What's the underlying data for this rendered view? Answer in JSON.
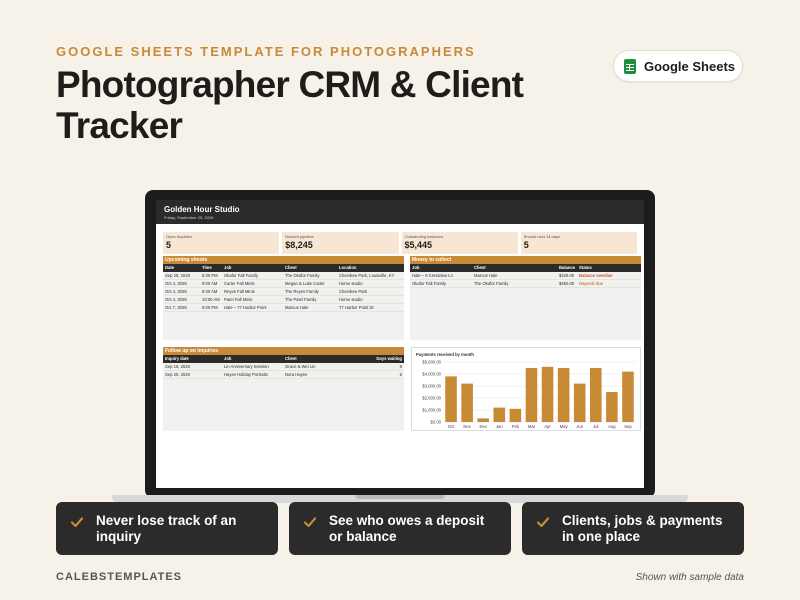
{
  "eyebrow": "GOOGLE SHEETS TEMPLATE FOR PHOTOGRAPHERS",
  "title": "Photographer CRM & Client Tracker",
  "badge": {
    "label": "Google Sheets",
    "icon": "google-sheets-icon",
    "icon_color": "#1e8e3e"
  },
  "sheet": {
    "studio": "Golden Hour Studio",
    "date": "Friday, September 25, 2026",
    "kpis": [
      {
        "label": "Open Inquiries",
        "value": "5"
      },
      {
        "label": "Booked pipeline",
        "value": "$8,245"
      },
      {
        "label": "Outstanding balances",
        "value": "$5,445"
      },
      {
        "label": "Shoots next 14 days",
        "value": "5"
      }
    ],
    "upcoming": {
      "title": "Upcoming shoots",
      "headers": [
        "Date",
        "Time",
        "Job",
        "Client",
        "Location"
      ],
      "rows": [
        [
          "Sep 29, 2026",
          "5:30 PM",
          "Okafor Fall Family",
          "The Okafor Family",
          "Cherokee Park, Louisville, KY"
        ],
        [
          "Oct 4, 2026",
          "9:00 AM",
          "Carter Fall Minis",
          "Megan & Luke Carter",
          "Home studio"
        ],
        [
          "Oct 4, 2026",
          "9:30 AM",
          "Reyes Fall Minis",
          "The Reyes Family",
          "Cherokee Park"
        ],
        [
          "Oct 4, 2026",
          "10:00 AM",
          "Patel Fall Minis",
          "The Patel Family",
          "Home studio"
        ],
        [
          "Oct 7, 2026",
          "6:00 PM",
          "Hale – 77 Harbor Point",
          "Marcus Hale",
          "77 Harbor Point Dr"
        ]
      ]
    },
    "money": {
      "title": "Money to collect",
      "headers": [
        "Job",
        "Client",
        "Balance",
        "Status"
      ],
      "rows": [
        [
          "Hale – 9 Crestview Ln",
          "Marcus Hale",
          "$425.00",
          "Balance overdue"
        ],
        [
          "Okafor Fall Family",
          "The Okafor Family",
          "$450.00",
          "Deposit due"
        ]
      ]
    },
    "followup": {
      "title": "Follow up on inquiries",
      "headers": [
        "Inquiry date",
        "Job",
        "Client",
        "Days waiting"
      ],
      "rows": [
        [
          "Sep 16, 2026",
          "Lin Anniversary Session",
          "Grace & Wei Lin",
          "9"
        ],
        [
          "Sep 20, 2026",
          "Hayes Holiday Portraits",
          "Nora Hayes",
          "5"
        ]
      ]
    }
  },
  "chart_data": {
    "type": "bar",
    "title": "Payments received by month",
    "categories": [
      "Oct",
      "Nov",
      "Dec",
      "Jan",
      "Feb",
      "Mar",
      "Apr",
      "May",
      "Jun",
      "Jul",
      "Aug",
      "Sep"
    ],
    "values": [
      3800,
      3200,
      300,
      1200,
      1100,
      4500,
      4600,
      4500,
      3200,
      4500,
      2500,
      4200
    ],
    "yticks": [
      "$0.00",
      "$1,000.00",
      "$2,000.00",
      "$3,000.00",
      "$4,000.00",
      "$5,000.00"
    ],
    "ylim": [
      0,
      5000
    ],
    "color": "#c98a36",
    "grid": true
  },
  "features": [
    {
      "text": "Never lose track of an inquiry",
      "icon": "checkmark-icon"
    },
    {
      "text": "See who owes a deposit or balance",
      "icon": "checkmark-icon"
    },
    {
      "text": "Clients, jobs & payments in one place",
      "icon": "checkmark-icon"
    }
  ],
  "accent_color": "#c98a36",
  "brand": "CALEBSTEMPLATES",
  "footnote": "Shown with sample data"
}
